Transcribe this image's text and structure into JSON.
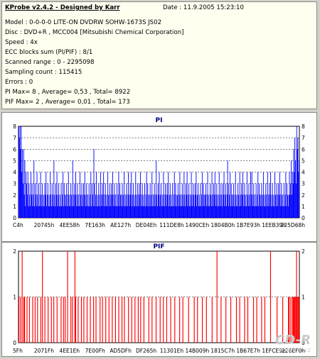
{
  "header": {
    "title": "KProbe v2.4.2 - Designed by Karr",
    "date": "Date : 11.9.2005 15:23:10",
    "lines": [
      "Model : 0-0-0-0 LITE-ON DVDRW SOHW-1673S JS02",
      "Disc : DVD+R , MCC004 [Mitsubishi Chemical Corporation]",
      "Speed : 4x",
      "ECC blocks sum (PI/PIF) : 8/1",
      "Scanned range : 0 - 2295098",
      "Sampling count : 115415",
      "Errors : 0",
      "PI Max= 8 , Average= 0,53 , Total= 8922",
      "PIF Max= 2 , Average= 0,01 , Total= 173"
    ]
  },
  "watermark": {
    "logo": "CD-R",
    "url": "www.cdr.cz"
  },
  "colors": {
    "pi": "#0000ff",
    "pif": "#ff0000",
    "title": "#000080",
    "grid": "#000000",
    "background": "#ffffff"
  },
  "chart_data": [
    {
      "type": "bar",
      "title": "PI",
      "ylim": [
        0,
        8
      ],
      "yticks": [
        "0",
        "1",
        "2",
        "3",
        "4",
        "5",
        "6",
        "7",
        "8"
      ],
      "xticks": [
        "C4h",
        "20745h",
        "4EE58h",
        "7E163h",
        "AE127h",
        "DE04Eh",
        "111DE8h",
        "1490CEh",
        "1804B0h",
        "1B7E93h",
        "1EEB39h",
        "225D68h"
      ],
      "grid": true,
      "series": [
        {
          "values": [
            8,
            7,
            8,
            6,
            8,
            4,
            6,
            3,
            6,
            2,
            5,
            1,
            4,
            3,
            2,
            4,
            1,
            3,
            2,
            1,
            4,
            2,
            3,
            1,
            2,
            5,
            1,
            3,
            2,
            1,
            4,
            2,
            1,
            3,
            1,
            2,
            4,
            1,
            2,
            3,
            1,
            2,
            1,
            3,
            2,
            4,
            1,
            2,
            3,
            1,
            2,
            1,
            4,
            2,
            1,
            3,
            2,
            1,
            5,
            2,
            1,
            3,
            2,
            4,
            1,
            2,
            3,
            1,
            2,
            1,
            3,
            1,
            2,
            4,
            1,
            3,
            2,
            1,
            2,
            3,
            1,
            2,
            4,
            1,
            2,
            1,
            3,
            2,
            1,
            5,
            2,
            1,
            3,
            2,
            4,
            1,
            2,
            3,
            1,
            2,
            1,
            4,
            2,
            1,
            3,
            2,
            1,
            3,
            2,
            4,
            1,
            2,
            3,
            1,
            2,
            1,
            3,
            1,
            2,
            4,
            1,
            3,
            2,
            1,
            6,
            3,
            1,
            2,
            4,
            1,
            2,
            1,
            3,
            2,
            1,
            4,
            2,
            1,
            3,
            2,
            4,
            1,
            2,
            3,
            1,
            2,
            1,
            4,
            2,
            1,
            3,
            2,
            1,
            3,
            2,
            4,
            1,
            2,
            3,
            1,
            2,
            1,
            3,
            1,
            2,
            4,
            1,
            3,
            2,
            1,
            2,
            3,
            1,
            2,
            4,
            1,
            2,
            1,
            3,
            2,
            1,
            4,
            2,
            1,
            3,
            2,
            4,
            1,
            2,
            3,
            1,
            2,
            1,
            4,
            2,
            1,
            3,
            2,
            1,
            3,
            2,
            4,
            1,
            2,
            3,
            1,
            2,
            1,
            3,
            1,
            2,
            4,
            1,
            3,
            2,
            1,
            2,
            3,
            1,
            2,
            4,
            1,
            2,
            1,
            3,
            2,
            1,
            5,
            2,
            1,
            3,
            2,
            4,
            1,
            2,
            3,
            1,
            2,
            1,
            4,
            2,
            1,
            3,
            2,
            1,
            3,
            2,
            4,
            1,
            2,
            3,
            1,
            2,
            1,
            3,
            1,
            2,
            4,
            1,
            3,
            2,
            1,
            2,
            3,
            1,
            2,
            4,
            1,
            2,
            1,
            3,
            2,
            1,
            4,
            2,
            1,
            3,
            2,
            4,
            1,
            2,
            3,
            1,
            2,
            1,
            4,
            2,
            1,
            3,
            2,
            1,
            3,
            2,
            4,
            1,
            2,
            3,
            1,
            2,
            1,
            3,
            1,
            2,
            4,
            1,
            3,
            2,
            1,
            2,
            3,
            1,
            2,
            4,
            1,
            2,
            1,
            3,
            2,
            1,
            4,
            2,
            1,
            3,
            2,
            4,
            1,
            2,
            3,
            1,
            2,
            1,
            4,
            2,
            1,
            3,
            2,
            1,
            3,
            2,
            4,
            1,
            2,
            3,
            1,
            2,
            5,
            3,
            1,
            2,
            4,
            1,
            3,
            2,
            1,
            2,
            3,
            1,
            2,
            4,
            1,
            2,
            1,
            3,
            2,
            1,
            4,
            2,
            1,
            3,
            2,
            4,
            1,
            2,
            3,
            1,
            2,
            1,
            4,
            2,
            1,
            3,
            2,
            1,
            4,
            2,
            4,
            1,
            2,
            3,
            1,
            2,
            1,
            3,
            1,
            2,
            4,
            1,
            3,
            2,
            1,
            2,
            3,
            1,
            2,
            4,
            1,
            2,
            1,
            3,
            2,
            1,
            4,
            2,
            1,
            3,
            2,
            4,
            1,
            2,
            3,
            1,
            2,
            1,
            4,
            2,
            1,
            3,
            2,
            1,
            3,
            2,
            4,
            1,
            2,
            3,
            1,
            2,
            1,
            3,
            1,
            2,
            4,
            1,
            3,
            2,
            1,
            2,
            4,
            2,
            3,
            5,
            2,
            4,
            3,
            6,
            4,
            7,
            5,
            3,
            8,
            6,
            7,
            4,
            5
          ]
        }
      ]
    },
    {
      "type": "bar",
      "title": "PIF",
      "ylim": [
        0,
        2
      ],
      "yticks": [
        "0",
        "1",
        "2"
      ],
      "xticks": [
        "5Fh",
        "2071Fh",
        "4EE1Eh",
        "7E00Fh",
        "AD5DFh",
        "DF265h",
        "11301Eh",
        "14B009h",
        "1815C7h",
        "1B67E7h",
        "1EFCE9h",
        "226EF0h"
      ],
      "grid": true,
      "series": [
        {
          "values": [
            1,
            0,
            1,
            0,
            2,
            0,
            1,
            1,
            0,
            0,
            1,
            0,
            0,
            1,
            0,
            0,
            0,
            1,
            0,
            0,
            1,
            0,
            0,
            1,
            0,
            0,
            0,
            1,
            0,
            2,
            0,
            0,
            1,
            0,
            0,
            0,
            1,
            0,
            0,
            0,
            1,
            0,
            0,
            1,
            0,
            0,
            0,
            1,
            0,
            0,
            0,
            0,
            1,
            0,
            0,
            1,
            0,
            1,
            0,
            0,
            2,
            0,
            0,
            0,
            1,
            0,
            1,
            0,
            0,
            2,
            1,
            0,
            0,
            1,
            0,
            0,
            0,
            1,
            0,
            0,
            1,
            0,
            0,
            0,
            1,
            0,
            0,
            0,
            1,
            0,
            0,
            0,
            1,
            0,
            0,
            1,
            0,
            0,
            0,
            0,
            1,
            0,
            0,
            1,
            0,
            0,
            0,
            1,
            0,
            0,
            0,
            1,
            0,
            0,
            0,
            1,
            0,
            0,
            0,
            1,
            0,
            0,
            0,
            1,
            0,
            0,
            0,
            1,
            0,
            0,
            1,
            0,
            0,
            0,
            0,
            1,
            0,
            0,
            0,
            1,
            0,
            0,
            0,
            1,
            0,
            0,
            0,
            1,
            0,
            0,
            1,
            0,
            0,
            0,
            1,
            0,
            0,
            0,
            0,
            0,
            1,
            0,
            0,
            0,
            1,
            0,
            0,
            0,
            0,
            1,
            0,
            0,
            0,
            0,
            1,
            0,
            0,
            0,
            1,
            0,
            0,
            0,
            1,
            0,
            0,
            0,
            0,
            1,
            0,
            0,
            0,
            0,
            1,
            0,
            0,
            0,
            0,
            0,
            1,
            0,
            0,
            0,
            1,
            0,
            0,
            0,
            0,
            0,
            0,
            1,
            0,
            0,
            0,
            0,
            0,
            0,
            1,
            0,
            0,
            0,
            1,
            0,
            0,
            0,
            0,
            0,
            1,
            0,
            0,
            0,
            0,
            1,
            0,
            0,
            0,
            0,
            0,
            0,
            1,
            0,
            0,
            0,
            0,
            0,
            2,
            0,
            0,
            0,
            0,
            1,
            0,
            0,
            0,
            0,
            0,
            1,
            0,
            0,
            0,
            0,
            0,
            1,
            0,
            0,
            0,
            0,
            0,
            0,
            1,
            0,
            0,
            0,
            1,
            0,
            0,
            0,
            0,
            0,
            1,
            0,
            0,
            0,
            1,
            0,
            0,
            0,
            0,
            0,
            0,
            1,
            0,
            0,
            0,
            1,
            0,
            0,
            0,
            0,
            0,
            1,
            0,
            0,
            0,
            1,
            0,
            0,
            0,
            0,
            0,
            0,
            2,
            0,
            0,
            0,
            0,
            0,
            0,
            0,
            1,
            0,
            0,
            0,
            0,
            0,
            0,
            1,
            0,
            0,
            0,
            0,
            0,
            0,
            1,
            1,
            0,
            1,
            0,
            1,
            1,
            1,
            1,
            1,
            2,
            1,
            1,
            1
          ]
        }
      ]
    }
  ]
}
